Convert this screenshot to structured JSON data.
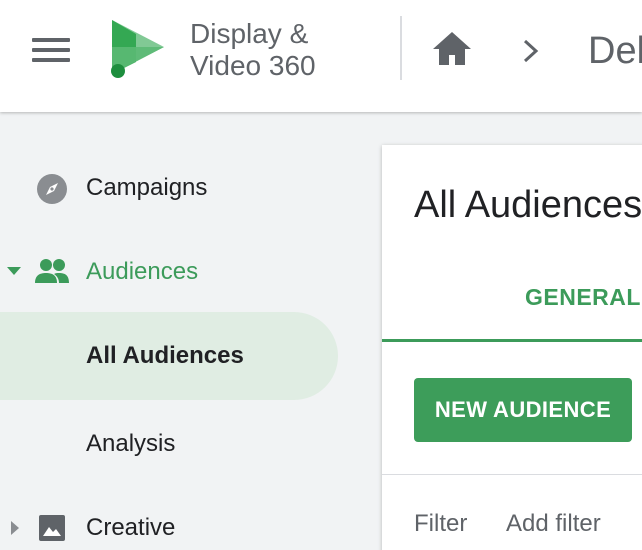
{
  "header": {
    "product_name_line1": "Display &",
    "product_name_line2": "Video 360",
    "breadcrumb_current": "Dek",
    "icons": {
      "menu": "hamburger-menu-icon",
      "logo": "display-video-360-logo",
      "home": "home-icon",
      "separator": "chevron-right-icon"
    }
  },
  "sidebar": {
    "items": [
      {
        "label": "Campaigns",
        "icon": "compass-icon"
      },
      {
        "label": "Audiences",
        "icon": "people-icon",
        "expanded": true
      },
      {
        "label": "All Audiences",
        "selected": true
      },
      {
        "label": "Analysis"
      },
      {
        "label": "Creative",
        "icon": "image-icon",
        "expanded": false
      }
    ]
  },
  "main": {
    "title": "All Audiences",
    "tab_general": "GENERAL",
    "new_audience_button": "NEW AUDIENCE",
    "filter_label": "Filter",
    "add_filter": "Add filter"
  },
  "colors": {
    "accent": "#3c9b5a",
    "selected_background": "#e0ede3",
    "icon_gray": "#5f6368",
    "page_background": "#f1f3f4"
  }
}
